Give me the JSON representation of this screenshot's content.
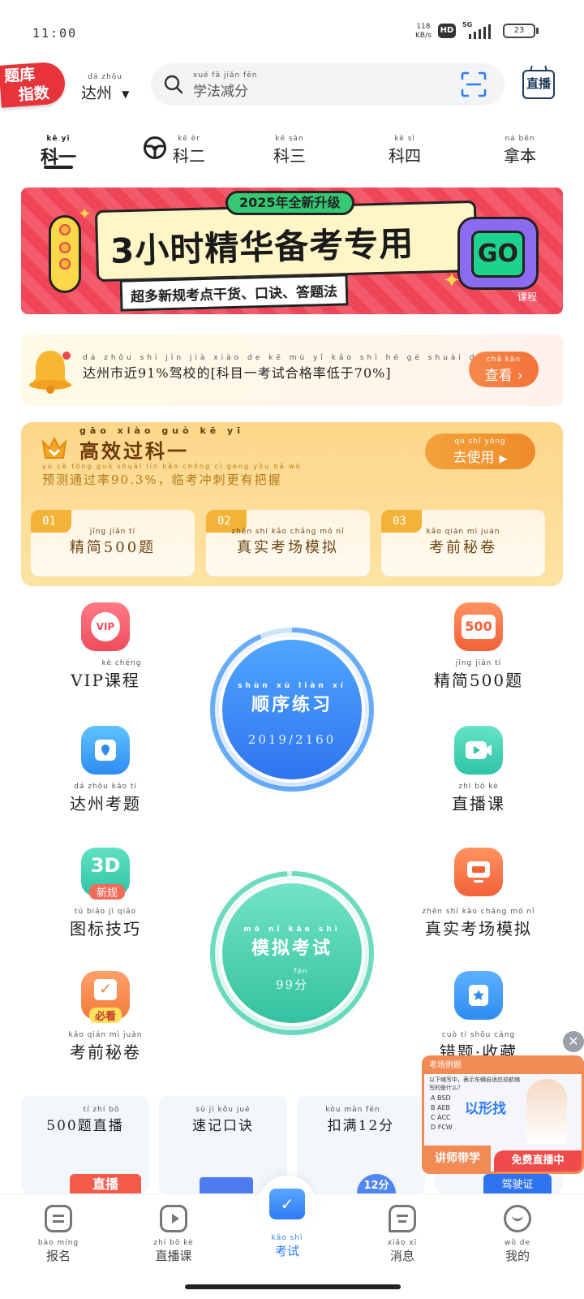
{
  "status_bar": {
    "time": "11:00",
    "speed": "118",
    "speed_unit": "KB/s",
    "hd": "HD",
    "network": "5G",
    "battery": "23"
  },
  "header": {
    "logo_line1": "题库",
    "logo_line2": "指数",
    "city": {
      "pinyin": "dá zhōu",
      "name": "达州"
    },
    "search_pinyin": "xué fǎ jiǎn fēn",
    "search_text": "学法减分",
    "live_label": "直播"
  },
  "tabs": [
    {
      "pinyin": "kē yī",
      "label": "科一",
      "active": true
    },
    {
      "pinyin": "kē èr",
      "label": "科二"
    },
    {
      "pinyin": "kē sān",
      "label": "科三"
    },
    {
      "pinyin": "kē sì",
      "label": "科四"
    },
    {
      "pinyin": "ná běn",
      "label": "拿本"
    }
  ],
  "banner": {
    "badge": "2025年全新升级",
    "headline": "3小时精华备考专用",
    "subline": "超多新规考点干货、口诀、答题法",
    "go_label": "GO",
    "course_tag": "课程"
  },
  "notice": {
    "pinyin": "dá zhōu shì jìn   jià xiào de   kē mù yī kǎo shì hé gé shuài dī yú",
    "text": "达州市近91%驾校的[科目一考试合格率低于70%]",
    "button_pinyin": "chá kàn",
    "button_label": "查看"
  },
  "promo": {
    "title_pinyin": "gāo xiào guò kē yī",
    "title": "高效过科一",
    "sub_pinyin": "yù cè tōng guò shuài   lín kǎo chōng cì gèng yǒu bǎ wò",
    "subtitle": "预测通过率90.3%，临考冲刺更有把握",
    "button_pinyin": "qù shǐ yòng",
    "button_label": "去使用",
    "features": [
      {
        "num": "01",
        "pinyin": "jīng jiǎn   tí",
        "label": "精简500题"
      },
      {
        "num": "02",
        "pinyin": "zhēn shí kǎo chǎng mó nǐ",
        "label": "真实考场模拟"
      },
      {
        "num": "03",
        "pinyin": "kǎo qián mì juàn",
        "label": "考前秘卷"
      }
    ]
  },
  "grid": {
    "left": [
      {
        "pinyin": "kè chéng",
        "label": "VIP课程",
        "icon": "vip-icon",
        "color": "#ef4f5f"
      },
      {
        "pinyin": "dá zhōu kǎo tí",
        "label": "达州考题",
        "icon": "location-icon",
        "color": "#2e8cf0"
      },
      {
        "pinyin": "tú biāo jì qiǎo",
        "label": "图标技巧",
        "icon": "3d-icon",
        "color": "#2ec4a6",
        "tag": "新规"
      },
      {
        "pinyin": "kǎo qián mì juàn",
        "label": "考前秘卷",
        "icon": "check-paper-icon",
        "color": "#f27a3a",
        "tag": "必看"
      }
    ],
    "right": [
      {
        "pinyin": "jīng jiǎn   tí",
        "label": "精简500题",
        "icon": "500-icon",
        "color": "#f26b3a",
        "icon_text": "500"
      },
      {
        "pinyin": "zhí bō kè",
        "label": "直播课",
        "icon": "video-icon",
        "color": "#2ec4a6"
      },
      {
        "pinyin": "zhēn shí kǎo chǎng mó nǐ",
        "label": "真实考场模拟",
        "icon": "monitor-icon",
        "color": "#f26b3a"
      },
      {
        "pinyin": "cuò tí shōu cáng",
        "label": "错题·收藏",
        "icon": "star-bookmark-icon",
        "color": "#2e8cf0"
      }
    ],
    "practice": {
      "pinyin": "shùn xù liàn xí",
      "label": "顺序练习",
      "progress": "2019/2160",
      "fraction": 0.935
    },
    "exam": {
      "pinyin": "mó nǐ kǎo shì",
      "label": "模拟考试",
      "score_pinyin": "fēn",
      "score": "99分",
      "fraction": 0.99
    }
  },
  "cards": [
    {
      "pinyin": "tí zhí bō",
      "label": "500题直播",
      "art": "直播"
    },
    {
      "pinyin": "sù jì kǒu jué",
      "label": "速记口诀"
    },
    {
      "pinyin": "kòu mǎn   fēn",
      "label": "扣满12分",
      "art": "12分"
    },
    {
      "art": "驾驶证"
    }
  ],
  "float_video": {
    "top_label": "考场例题",
    "question": "以下缩写中，表示车辆自适应巡航缩写的是什么？",
    "options": [
      "A BSD",
      "B AEB",
      "C ACC",
      "D FCW"
    ],
    "headline": "以形找",
    "left_tag": "讲师带学",
    "right_tag": "免费直播中"
  },
  "nav": [
    {
      "pinyin": "bào míng",
      "label": "报名",
      "icon": "signup-icon"
    },
    {
      "pinyin": "zhí bō kè",
      "label": "直播课",
      "icon": "tv-icon"
    },
    {
      "pinyin": "kǎo shì",
      "label": "考试",
      "icon": "exam-folder-icon",
      "active": true
    },
    {
      "pinyin": "xiāo xī",
      "label": "消息",
      "icon": "message-icon"
    },
    {
      "pinyin": "wǒ de",
      "label": "我的",
      "icon": "profile-icon"
    }
  ],
  "colors": {
    "accent": "#2e7cf6",
    "exam_green": "#3fd4ac",
    "promo_orange": "#f08a2e"
  }
}
